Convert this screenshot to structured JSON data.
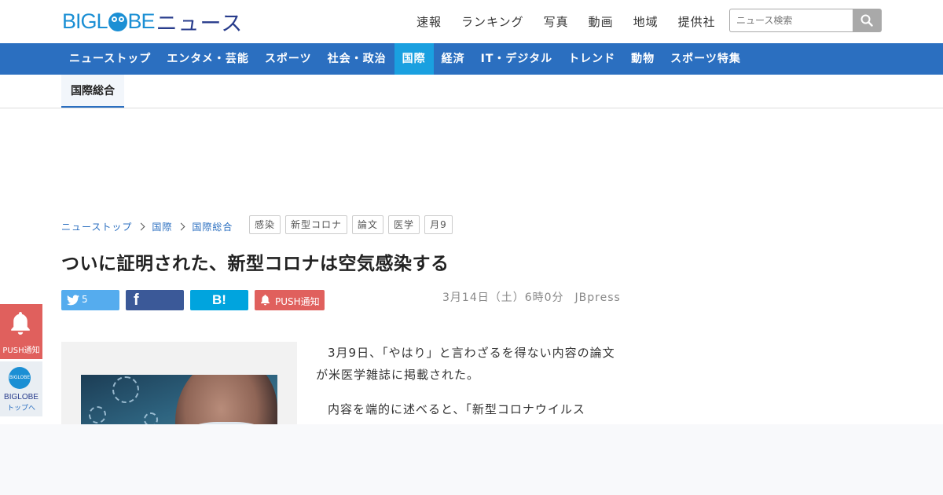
{
  "header": {
    "logo_latin": "BIGL",
    "logo_latin_end": "BE",
    "logo_news": "ニュース",
    "topnav": [
      "速報",
      "ランキング",
      "写真",
      "動画",
      "地域",
      "提供社"
    ],
    "search_placeholder": "ニュース検索"
  },
  "mainnav": {
    "items": [
      "ニューストップ",
      "エンタメ・芸能",
      "スポーツ",
      "社会・政治",
      "国際",
      "経済",
      "IT・デジタル",
      "トレンド",
      "動物",
      "スポーツ特集"
    ],
    "active": "国際"
  },
  "subnav": {
    "active": "国際総合"
  },
  "breadcrumb": [
    "ニューストップ",
    "国際",
    "国際総合"
  ],
  "tags": [
    "感染",
    "新型コロナ",
    "論文",
    "医学",
    "月9"
  ],
  "article": {
    "title": "ついに証明された、新型コロナは空気感染する",
    "date": "3月14日（土）6時0分",
    "source": "JBpress",
    "paragraphs": [
      "3月9日、「やはり」と言わざるを得ない内容の論文が米医学雑誌に掲載された。",
      "内容を端的に述べると、「新型コロナウイルス"
    ]
  },
  "share": {
    "twitter_count": "5",
    "facebook_glyph": "f",
    "hatena_glyph": "B!",
    "push_label": "PUSH通知"
  },
  "side": {
    "push_label": "PUSH通知",
    "badge_text": "BIGLOBE",
    "top_line1": "BIGLOBE",
    "top_line2": "トップへ"
  },
  "colors": {
    "brand_blue": "#1b8fd4",
    "nav_blue": "#2b6fc0",
    "active_tab": "#1aa0e0",
    "push_red": "#e0605d"
  }
}
